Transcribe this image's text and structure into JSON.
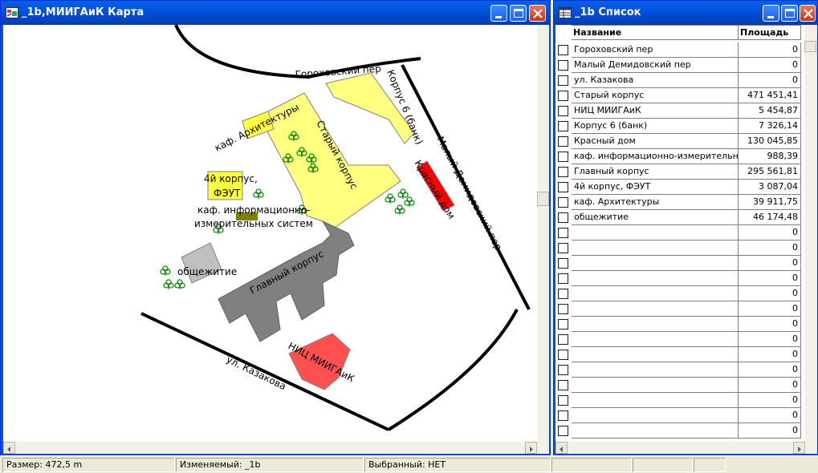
{
  "map_window": {
    "title": "_1b,МИИГАиК Карта",
    "labels": {
      "gorokhovsky": "Гороховский пер",
      "korpus6": "Корпус 6 (банк)",
      "stary": "Старый корпус",
      "arch": "каф. Архитектуры",
      "korp4_1": "4й корпус,",
      "korp4_2": "ФЭУТ",
      "info_1": "каф. информационно-",
      "info_2": "измерительных систем",
      "krasny": "Красный дом",
      "demidovsky": "Малый Демидовский пер",
      "obsch": "общежитие",
      "glavny": "Главный корпус",
      "nits": "НИЦ МИИГАиК",
      "kazakova": "ул. Казакова"
    }
  },
  "list_window": {
    "title": "_1b Список",
    "columns": [
      "Название",
      "Площадь"
    ],
    "rows": [
      {
        "name": "Гороховский пер",
        "area": "0"
      },
      {
        "name": "Малый Демидовский пер",
        "area": "0"
      },
      {
        "name": "ул. Казакова",
        "area": "0"
      },
      {
        "name": "Старый корпус",
        "area": "471 451,41"
      },
      {
        "name": "НИЦ МИИГАиК",
        "area": "5 454,87"
      },
      {
        "name": "Корпус 6 (банк)",
        "area": "7 326,14"
      },
      {
        "name": "Красный дом",
        "area": "130 045,85"
      },
      {
        "name": "каф. информационно-измерительные с",
        "area": "988,39"
      },
      {
        "name": "Главный корпус",
        "area": "295 561,81"
      },
      {
        "name": "4й корпус, ФЭУТ",
        "area": "3 087,04"
      },
      {
        "name": "каф. Архитектуры",
        "area": "39 911,75"
      },
      {
        "name": "общежитие",
        "area": "46 174,48"
      },
      {
        "name": "",
        "area": "0"
      },
      {
        "name": "",
        "area": "0"
      },
      {
        "name": "",
        "area": "0"
      },
      {
        "name": "",
        "area": "0"
      },
      {
        "name": "",
        "area": "0"
      },
      {
        "name": "",
        "area": "0"
      },
      {
        "name": "",
        "area": "0"
      },
      {
        "name": "",
        "area": "0"
      },
      {
        "name": "",
        "area": "0"
      },
      {
        "name": "",
        "area": "0"
      },
      {
        "name": "",
        "area": "0"
      },
      {
        "name": "",
        "area": "0"
      },
      {
        "name": "",
        "area": "0"
      },
      {
        "name": "",
        "area": "0"
      }
    ]
  },
  "statusbar": {
    "size": "Размер: 472,5 m",
    "editable": "Изменяемый: _1b",
    "selected": "Выбранный: НЕТ"
  },
  "colors": {
    "building_yellow": "#ffff80",
    "building_gray": "#808080",
    "building_red": "#ff0000",
    "building_salmon": "#ff5050",
    "building_lightgray": "#c0c0c0",
    "tree_green": "#008000",
    "titlebar_blue": "#0054e3"
  },
  "icons": [
    "map-window-icon",
    "list-window-icon",
    "minimize-icon",
    "maximize-icon",
    "close-icon",
    "tree-icon"
  ]
}
